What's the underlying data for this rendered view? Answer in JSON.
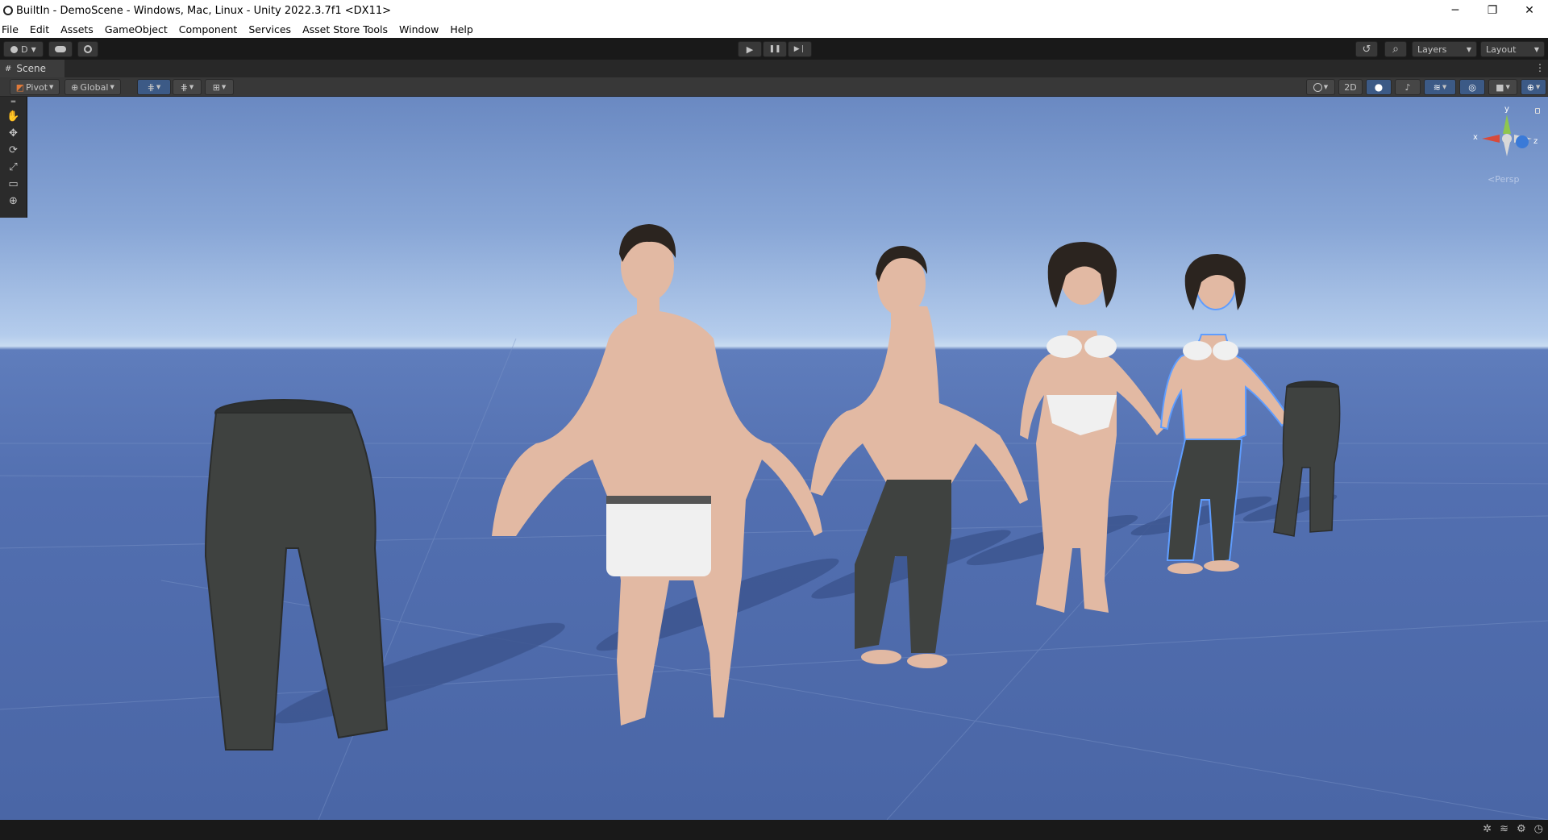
{
  "window": {
    "title": "BuiltIn - DemoScene - Windows, Mac, Linux - Unity 2022.3.7f1 <DX11>",
    "controls": [
      "─",
      "❐",
      "✕"
    ]
  },
  "menu": [
    "File",
    "Edit",
    "Assets",
    "GameObject",
    "Component",
    "Services",
    "Asset Store Tools",
    "Window",
    "Help"
  ],
  "toolbar": {
    "account_label": "D",
    "play_icon": "▶",
    "pause_icon": "❚❚",
    "step_icon": "▶❘",
    "history_icon": "↺",
    "search_icon": "⌕",
    "layers_label": "Layers",
    "layout_label": "Layout"
  },
  "scene_tab": {
    "label": "Scene",
    "menu_icon": "⋮"
  },
  "scene_toolbar": {
    "pivot_label": "Pivot",
    "global_label": "Global",
    "mode_2d": "2D"
  },
  "gizmo": {
    "x": "x",
    "y": "y",
    "z": "z",
    "projection": "<Persp"
  },
  "tools": [
    "✋",
    "✥",
    "⟳",
    "⤢",
    "▭",
    "⊕"
  ],
  "status_icons": [
    "✲",
    "≋",
    "⚙",
    "◷"
  ],
  "colors": {
    "sky_top": "#6a89c2",
    "horizon": "#c8dbf1",
    "ground": "#526fb0",
    "skin": "#e2b9a3",
    "jeans": "#3f4240",
    "underwear": "#f0f0f0",
    "hair": "#2b241f"
  }
}
